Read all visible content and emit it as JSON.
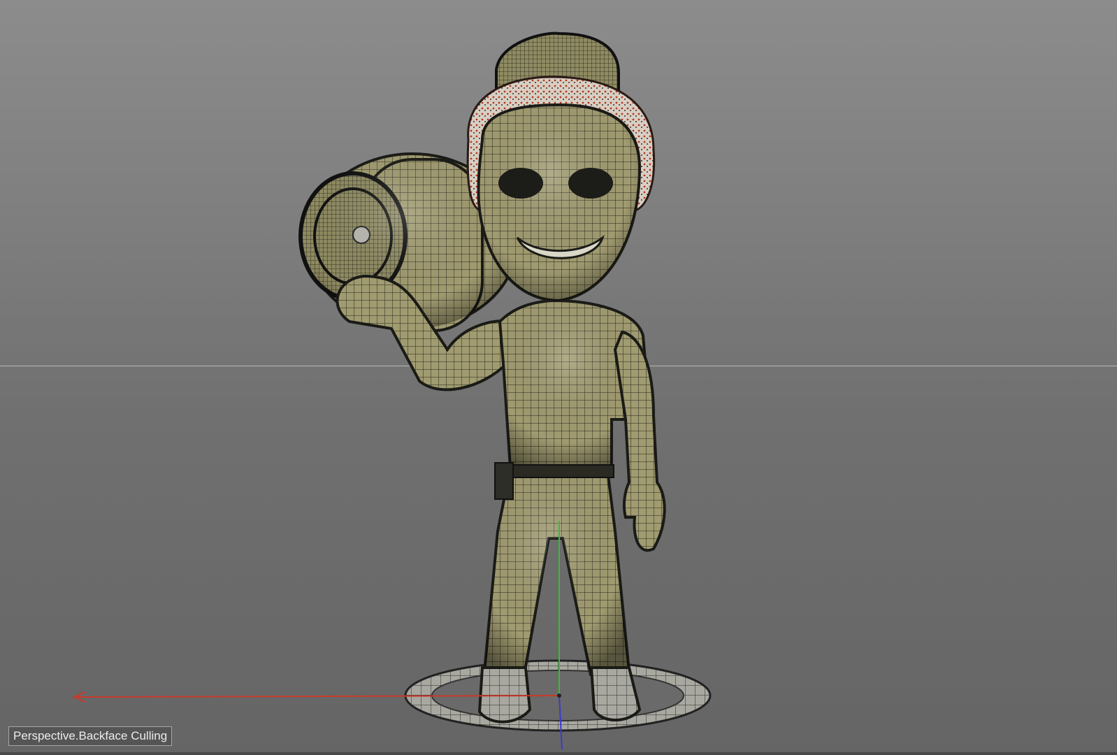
{
  "viewport": {
    "label": "Perspective.Backface Culling",
    "mode": "wireframe-shaded",
    "axis_colors": {
      "x": "#c83a2a",
      "y": "#3fb83f",
      "z": "#3a3ad0"
    },
    "mesh_color": "#9a966c",
    "wire_color": "#1c1c18"
  }
}
